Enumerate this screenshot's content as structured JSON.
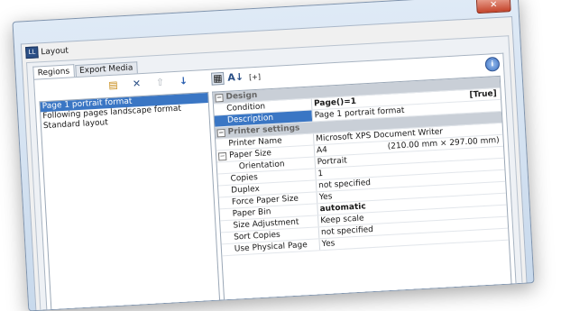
{
  "window": {
    "close_label": "✕"
  },
  "dialog": {
    "icon_text": "LL",
    "title": "Layout"
  },
  "tabs": [
    "Regions",
    "Export Media"
  ],
  "left_toolbar": [
    {
      "name": "new-region-icon",
      "glyph": "▤"
    },
    {
      "name": "delete-icon",
      "glyph": "✕"
    },
    {
      "name": "move-up-icon",
      "glyph": "⇧"
    },
    {
      "name": "move-down-icon",
      "glyph": "↓"
    }
  ],
  "regions": [
    {
      "label": "Page 1 portrait format",
      "selected": true
    },
    {
      "label": "Following pages landscape format",
      "selected": false
    },
    {
      "label": "Standard layout",
      "selected": false
    }
  ],
  "right_toolbar": {
    "categorized_icon": "▦",
    "sort_icon": "A↓",
    "expand_label": "[+]",
    "info_icon": "i"
  },
  "properties": {
    "design_label": "Design",
    "condition_name": "Condition",
    "condition_value": "Page()=1",
    "condition_flag": "[True]",
    "description_name": "Description",
    "description_value": "Page 1 portrait format",
    "printer_label": "Printer settings",
    "printer_name": "Printer Name",
    "printer_value": "Microsoft XPS Document Writer",
    "paper_size_name": "Paper Size",
    "paper_size_value": "A4",
    "paper_size_dims": "(210.00 mm × 297.00 mm)",
    "orientation_name": "Orientation",
    "orientation_value": "Portrait",
    "copies_name": "Copies",
    "copies_value": "1",
    "duplex_name": "Duplex",
    "duplex_value": "not specified",
    "force_name": "Force Paper Size",
    "force_value": "Yes",
    "bin_name": "Paper Bin",
    "bin_value": "automatic",
    "size_adj_name": "Size Adjustment",
    "size_adj_value": "Keep scale",
    "sort_name": "Sort Copies",
    "sort_value": "not specified",
    "physical_name": "Use Physical Page",
    "physical_value": "Yes"
  }
}
